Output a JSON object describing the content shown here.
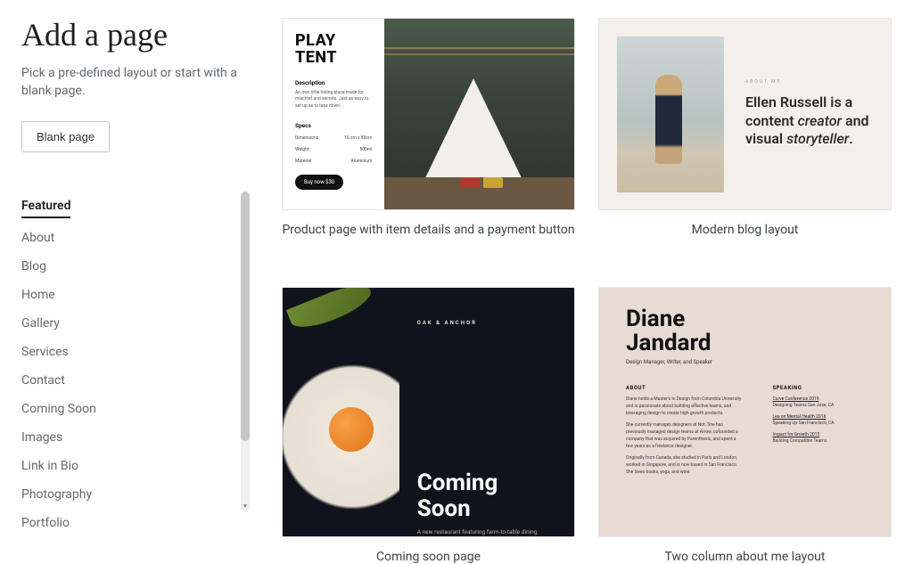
{
  "header": {
    "title": "Add a page",
    "subtitle": "Pick a pre-defined layout or start with a blank page.",
    "blank_button": "Blank page"
  },
  "categories": [
    {
      "label": "Featured",
      "active": true
    },
    {
      "label": "About",
      "active": false
    },
    {
      "label": "Blog",
      "active": false
    },
    {
      "label": "Home",
      "active": false
    },
    {
      "label": "Gallery",
      "active": false
    },
    {
      "label": "Services",
      "active": false
    },
    {
      "label": "Contact",
      "active": false
    },
    {
      "label": "Coming Soon",
      "active": false
    },
    {
      "label": "Images",
      "active": false
    },
    {
      "label": "Link in Bio",
      "active": false
    },
    {
      "label": "Photography",
      "active": false
    },
    {
      "label": "Portfolio",
      "active": false
    }
  ],
  "templates": [
    {
      "caption": "Product page with item details and a payment button",
      "preview": {
        "title_line1": "PLAY",
        "title_line2": "TENT",
        "desc_heading": "Description",
        "desc_body": "An own little hiding place made for mischief and secrets. Just as easy to set up as to take down.",
        "specs_heading": "Specs",
        "spec_rows": [
          [
            "Dimensions",
            "10.cm x 80cm"
          ],
          [
            "Weight",
            "500ml"
          ],
          [
            "Material",
            "Aluminium"
          ]
        ],
        "buy_button": "Buy now $30"
      }
    },
    {
      "caption": "Modern blog layout",
      "preview": {
        "kicker": "ABOUT ME",
        "head_pre": "Ellen Russell is a content ",
        "head_em1": "creator",
        "head_mid": " and visual ",
        "head_em2": "storyteller",
        "head_post": "."
      }
    },
    {
      "caption": "Coming soon page",
      "preview": {
        "brand": "OAK & ANCHOR",
        "heading_line1": "Coming",
        "heading_line2": "Soon",
        "desc": "A new restaurant featuring farm-to-table dining"
      }
    },
    {
      "caption": "Two column about me layout",
      "preview": {
        "name_line1": "Diane",
        "name_line2": "Jandard",
        "role": "Design Manager, Writer, and Speaker",
        "about_heading": "ABOUT",
        "about_paras": [
          "Diane holds a Master's in Design from Columbia University and is passionate about building effective teams, and leveraging design to create high-growth products.",
          "She currently manages designers at Not. She has previously managed design teams at Arrow, cofounded a company that was acquired by Parenthesis, and spent a few years as a freelance designer.",
          "Originally from Canada, she studied in Paris and London, worked in Singapore, and is now based in San Francisco. She loves books, yoga, and wine."
        ],
        "speaking_heading": "SPEAKING",
        "speaking_items": [
          {
            "title": "Curve Conference 2019",
            "sub": "Designing Teams\nSan Jose, CA"
          },
          {
            "title": "Lea on Mental Health 2018",
            "sub": "Speaking Up\nSan Francisco, CA"
          },
          {
            "title": "Impact for Growth 2015",
            "sub": "Building Compatible Teams"
          }
        ]
      }
    }
  ]
}
